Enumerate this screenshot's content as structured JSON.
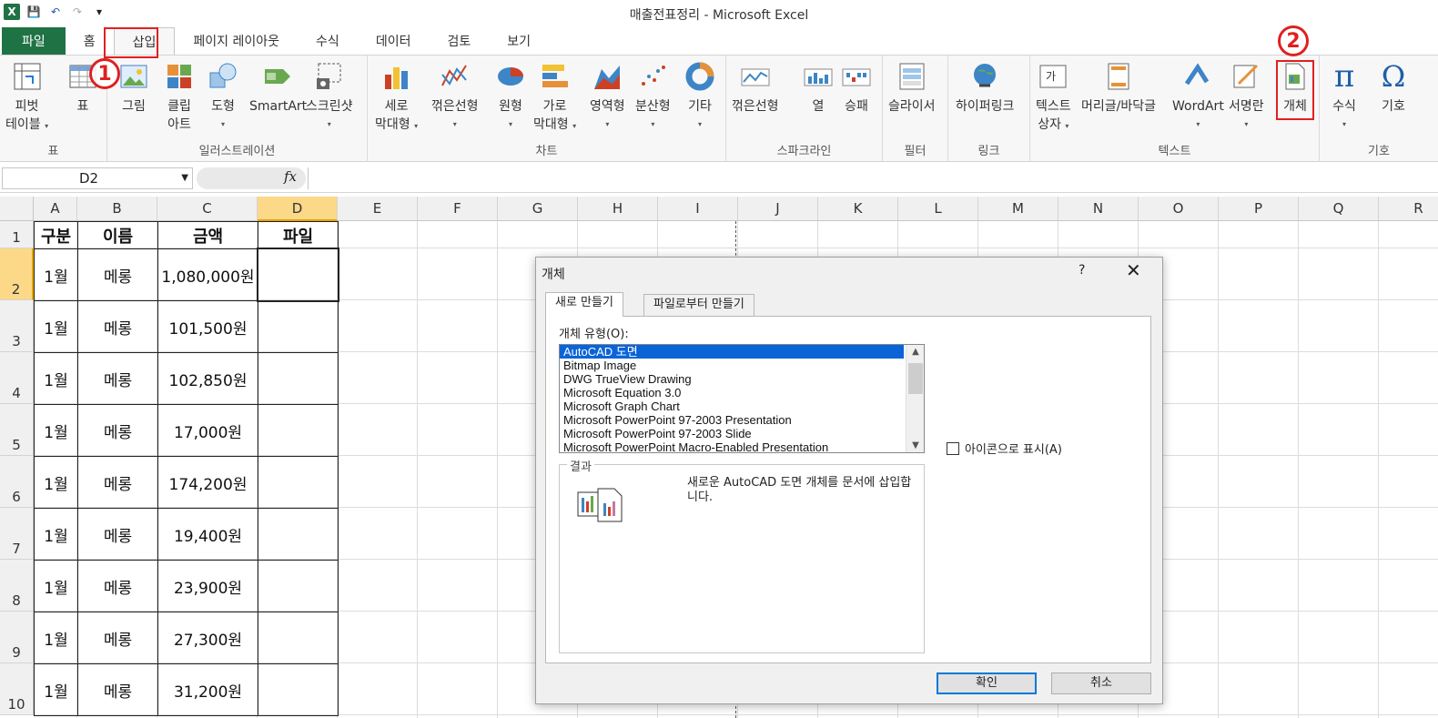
{
  "window": {
    "title": "매출전표정리  -  Microsoft Excel"
  },
  "qat": {
    "logo": "X",
    "save": "💾",
    "undo": "↶",
    "redo": "↷",
    "more": "▾"
  },
  "tabs": [
    "파일",
    "홈",
    "삽입",
    "페이지 레이아웃",
    "수식",
    "데이터",
    "검토",
    "보기"
  ],
  "annotations": {
    "step1": "1",
    "step2": "2"
  },
  "ribbon": {
    "groups": {
      "table": "표",
      "illust": "일러스트레이션",
      "chart": "차트",
      "spark": "스파크라인",
      "filter": "필터",
      "link": "링크",
      "text": "텍스트",
      "symbol": "기호"
    },
    "buttons": {
      "pivot1": "피벗",
      "pivot2": "테이블",
      "table": "표",
      "picture": "그림",
      "clipart1": "클립",
      "clipart2": "아트",
      "shapes": "도형",
      "smartart": "SmartArt",
      "screenshot": "스크린샷",
      "col1": "세로",
      "col2": "막대형",
      "line": "꺾은선형",
      "pie": "원형",
      "bar1": "가로",
      "bar2": "막대형",
      "area": "영역형",
      "scatter": "분산형",
      "other": "기타",
      "sline": "꺾은선형",
      "scol": "열",
      "swl": "승패",
      "slicer": "슬라이서",
      "hyperlink": "하이퍼링크",
      "textbox1": "텍스트",
      "textbox2": "상자",
      "headfoot": "머리글/바닥글",
      "wordart": "WordArt",
      "sigline": "서명란",
      "object": "개체",
      "equation": "수식",
      "symbol": "기호"
    }
  },
  "formula": {
    "namebox": "D2",
    "fx": "fx",
    "value": ""
  },
  "columns": [
    "A",
    "B",
    "C",
    "D",
    "E",
    "F",
    "G",
    "H",
    "I",
    "J",
    "K",
    "L",
    "M",
    "N",
    "O",
    "P",
    "Q",
    "R"
  ],
  "rows": [
    "1",
    "2",
    "3",
    "4",
    "5",
    "6",
    "7",
    "8",
    "9",
    "10"
  ],
  "table": {
    "headers": [
      "구분",
      "이름",
      "금액",
      "파일"
    ],
    "rows": [
      [
        "1월",
        "메롱",
        "1,080,000원",
        ""
      ],
      [
        "1월",
        "메롱",
        "101,500원",
        ""
      ],
      [
        "1월",
        "메롱",
        "102,850원",
        ""
      ],
      [
        "1월",
        "메롱",
        "17,000원",
        ""
      ],
      [
        "1월",
        "메롱",
        "174,200원",
        ""
      ],
      [
        "1월",
        "메롱",
        "19,400원",
        ""
      ],
      [
        "1월",
        "메롱",
        "23,900원",
        ""
      ],
      [
        "1월",
        "메롱",
        "27,300원",
        ""
      ],
      [
        "1월",
        "메롱",
        "31,200원",
        ""
      ]
    ]
  },
  "dialog": {
    "title": "개체",
    "help": "?",
    "close": "✕",
    "tab_new": "새로 만들기",
    "tab_file": "파일로부터 만들기",
    "type_label": "개체 유형(O):",
    "types": [
      "AutoCAD 도면",
      "Bitmap Image",
      "DWG TrueView Drawing",
      "Microsoft Equation 3.0",
      "Microsoft Graph Chart",
      "Microsoft PowerPoint 97-2003 Presentation",
      "Microsoft PowerPoint 97-2003 Slide",
      "Microsoft PowerPoint Macro-Enabled Presentation"
    ],
    "display_as_icon": "아이콘으로 표시(A)",
    "result_label": "결과",
    "result_text": "새로운 AutoCAD 도면 개체를 문서에 삽입합니다.",
    "ok": "확인",
    "cancel": "취소"
  },
  "colors": {
    "excel_green": "#1f7244",
    "highlight_red": "#e02020",
    "selection": "#0a64d8"
  }
}
